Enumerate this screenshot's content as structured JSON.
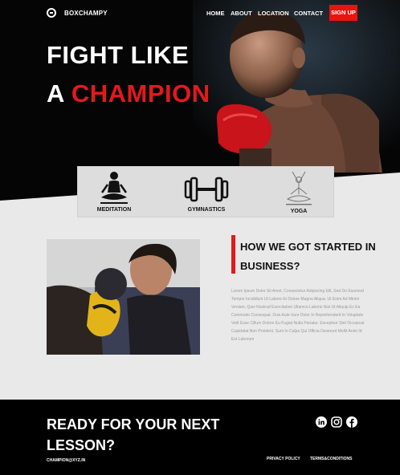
{
  "nav": {
    "brand": "BOXCHAMPY",
    "links": [
      "HOME",
      "ABOUT",
      "LOCATION",
      "CONTACT"
    ],
    "signup": "SIGN UP"
  },
  "hero": {
    "line1": "FIGHT LIKE",
    "line2_prefix": "A ",
    "line2_highlight": "CHAMPION"
  },
  "activities": [
    {
      "label": "MEDITATION",
      "icon": "meditation-icon"
    },
    {
      "label": "GYMNASTICS",
      "icon": "dumbbell-icon"
    },
    {
      "label": "YOGA",
      "icon": "yoga-icon"
    }
  ],
  "story": {
    "title": "HOW WE GOT STARTED IN BUSINESS?",
    "body": "Lorem Ipsum Dolor Sit Amet, Consectetur Adipiscing Elit, Sed Do Eiusmod Tempor Incididunt Ut Labore Et Dolore Magna Aliqua. Ut Enim Ad Minim Veniam, Quis Nostrud Exercitation Ullamco Laboris Nisi Ut Aliquip Ex Ea Commodo Consequat. Duis Aute Irure Dolor In Reprehenderit In Voluptate Velit Esse Cillum Dolore Eu Fugiat Nulla Pariatur. Excepteur Sint Occaecat Cupidatat Non Proident, Sunt In Culpa Qui Officia Deserunt Mollit Anim Id Est Laborum"
  },
  "footer": {
    "cta": "READY FOR YOUR NEXT LESSON?",
    "email": "CHAMPION@XYZ.IN",
    "privacy": "PRIVACY POLICY",
    "terms": "TERMS&CONDITIONS",
    "social": [
      "linkedin-icon",
      "instagram-icon",
      "facebook-icon"
    ]
  },
  "colors": {
    "accent": "#e3191a",
    "dark": "#000000",
    "light": "#e9e9e9"
  }
}
